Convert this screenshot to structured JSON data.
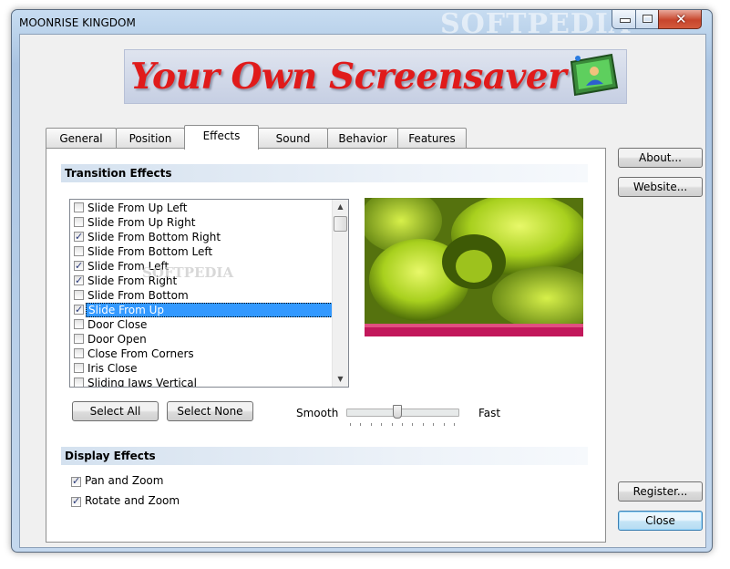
{
  "window": {
    "title": "MOONRISE KINGDOM",
    "watermark": "SOFTPEDIA",
    "close_glyph": "✕"
  },
  "banner": {
    "your": "Your",
    "own": "Own",
    "screensaver": "Screensaver",
    "icon": "screen-user-icon"
  },
  "tabs": [
    {
      "label": "General"
    },
    {
      "label": "Position"
    },
    {
      "label": "Effects",
      "active": true
    },
    {
      "label": "Sound"
    },
    {
      "label": "Behavior"
    },
    {
      "label": "Features"
    }
  ],
  "transition": {
    "header": "Transition Effects",
    "items": [
      {
        "label": "Slide From Up Left",
        "checked": false
      },
      {
        "label": "Slide From Up Right",
        "checked": false
      },
      {
        "label": "Slide From Bottom Right",
        "checked": true
      },
      {
        "label": "Slide From Bottom Left",
        "checked": false
      },
      {
        "label": "Slide From Left",
        "checked": true
      },
      {
        "label": "Slide From Right",
        "checked": true
      },
      {
        "label": "Slide From Bottom",
        "checked": false
      },
      {
        "label": "Slide From Up",
        "checked": true,
        "selected": true
      },
      {
        "label": "Door Close",
        "checked": false
      },
      {
        "label": "Door Open",
        "checked": false
      },
      {
        "label": "Close From Corners",
        "checked": false
      },
      {
        "label": "Iris Close",
        "checked": false
      },
      {
        "label": "Sliding Jaws Vertical",
        "checked": false
      }
    ],
    "select_all": "Select All",
    "select_none": "Select None",
    "speed": {
      "low_label": "Smooth",
      "high_label": "Fast",
      "value": 0.45
    }
  },
  "display": {
    "header": "Display Effects",
    "pan_zoom": {
      "label": "Pan and Zoom",
      "checked": true
    },
    "rotate_zoom": {
      "label": "Rotate and Zoom",
      "checked": true
    }
  },
  "side_buttons": {
    "about": "About...",
    "website": "Website...",
    "register": "Register...",
    "close": "Close"
  },
  "preview_watermark": "SOFTPEDIA",
  "colors": {
    "selection": "#3399ff",
    "title_red": "#e01b1b",
    "title_blue": "#1b2a9a"
  }
}
